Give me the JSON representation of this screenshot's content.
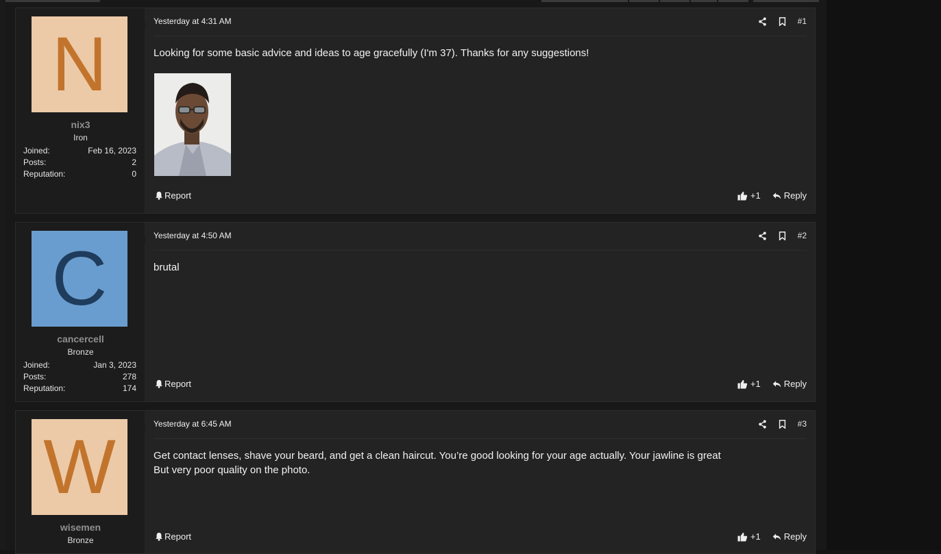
{
  "posts": [
    {
      "avatar_letter": "N",
      "avatar_bg": "#eccaa8",
      "avatar_fg": "#c2742c",
      "username": "nix3",
      "rank": "Iron",
      "stats": [
        {
          "label": "Joined:",
          "value": "Feb 16, 2023"
        },
        {
          "label": "Posts:",
          "value": "2"
        },
        {
          "label": "Reputation:",
          "value": "0"
        }
      ],
      "date": "Yesterday at 4:31 AM",
      "number": "#1",
      "body_lines": [
        "Looking for some basic advice and ideas to age gracefully (I'm 37). Thanks for any suggestions!"
      ],
      "has_photo": true,
      "report_label": "Report",
      "like_label": "+1",
      "reply_label": "Reply"
    },
    {
      "avatar_letter": "C",
      "avatar_bg": "#6a9dcf",
      "avatar_fg": "#1f3c5c",
      "username": "cancercell",
      "rank": "Bronze",
      "stats": [
        {
          "label": "Joined:",
          "value": "Jan 3, 2023"
        },
        {
          "label": "Posts:",
          "value": "278"
        },
        {
          "label": "Reputation:",
          "value": "174"
        }
      ],
      "date": "Yesterday at 4:50 AM",
      "number": "#2",
      "body_lines": [
        "brutal"
      ],
      "has_photo": false,
      "report_label": "Report",
      "like_label": "+1",
      "reply_label": "Reply"
    },
    {
      "avatar_letter": "W",
      "avatar_bg": "#eccaa8",
      "avatar_fg": "#c2742c",
      "username": "wisemen",
      "rank": "Bronze",
      "stats": [],
      "date": "Yesterday at 6:45 AM",
      "number": "#3",
      "body_lines": [
        "Get contact lenses, shave your beard, and get a clean haircut. You’re good looking for your age actually. Your jawline is great",
        "But very poor quality on the photo."
      ],
      "has_photo": false,
      "report_label": "Report",
      "like_label": "+1",
      "reply_label": "Reply"
    }
  ],
  "icons": {
    "share": "share-icon",
    "bookmark": "bookmark-icon",
    "report": "bell-icon",
    "like": "thumbs-up-icon",
    "reply": "reply-icon"
  },
  "colors": {
    "background": "#141414",
    "post_bg": "#232323",
    "sidebar_bg": "#1c1c1c",
    "username": "#8f8f8f"
  }
}
